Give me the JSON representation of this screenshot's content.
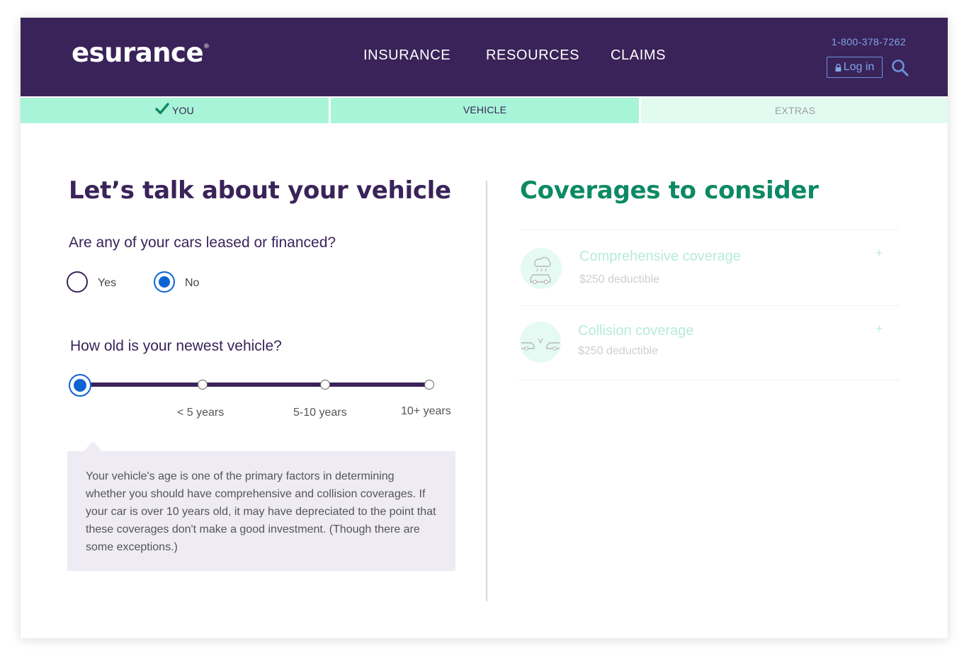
{
  "header": {
    "logo_text": "esurance",
    "logo_mark": "®",
    "nav": [
      "INSURANCE",
      "RESOURCES",
      "CLAIMS"
    ],
    "phone": "1-800-378-7262",
    "login_label": "Log in",
    "background_color": "#3a2359"
  },
  "steps": [
    {
      "label": "YOU",
      "state": "complete"
    },
    {
      "label": "VEHICLE",
      "state": "current"
    },
    {
      "label": "EXTRAS",
      "state": "upcoming"
    }
  ],
  "vehicle": {
    "title": "Let’s talk about your vehicle",
    "leased_question": "Are any of your cars leased or financed?",
    "options": [
      "Yes",
      "No"
    ],
    "selected_option": "No",
    "age_question": "How old is your newest vehicle?",
    "age_labels": [
      "< 5 years",
      "5-10 years",
      "10+ years"
    ],
    "age_selected_index": 0,
    "info_text": "Your vehicle's age is one of the primary factors in determining whether you should have comprehensive and collision coverages. If your car is over 10 years old, it may have depreciated to the point that these coverages don't make a good investment. (Though there are some exceptions.)"
  },
  "coverages": {
    "title": "Coverages to consider",
    "items": [
      {
        "name": "Comprehensive coverage",
        "detail": "$250 deductible",
        "icon": "storm-car-icon"
      },
      {
        "name": "Collision coverage",
        "detail": "$250 deductible",
        "icon": "car-collision-icon"
      }
    ],
    "expand_symbol": "+"
  },
  "colors": {
    "brand_purple": "#3a2359",
    "accent_green": "#0d8a63",
    "step_green": "#a8f4d8",
    "selection_blue": "#0e63d4"
  }
}
